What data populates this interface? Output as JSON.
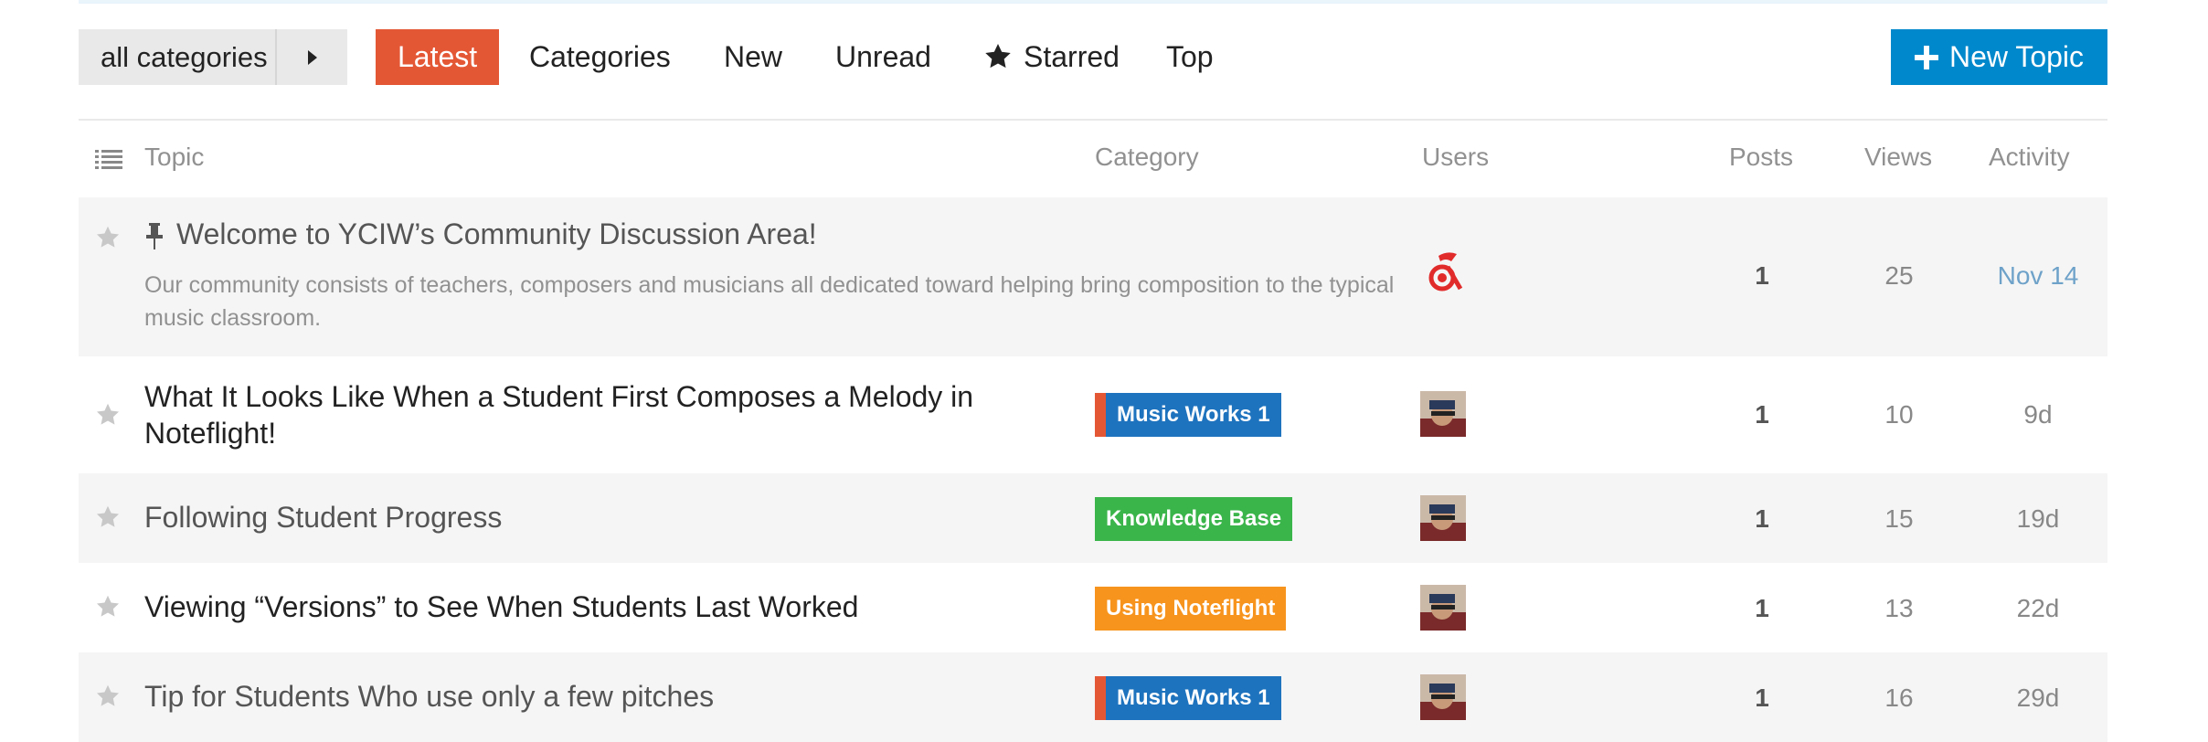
{
  "nav": {
    "category_dropdown": "all categories",
    "items": [
      {
        "label": "Latest",
        "active": true
      },
      {
        "label": "Categories",
        "active": false
      },
      {
        "label": "New",
        "active": false
      },
      {
        "label": "Unread",
        "active": false
      },
      {
        "label": "Starred",
        "active": false,
        "icon": "star-icon"
      },
      {
        "label": "Top",
        "active": false
      }
    ],
    "new_topic_label": "New Topic"
  },
  "columns": {
    "topic": "Topic",
    "category": "Category",
    "users": "Users",
    "posts": "Posts",
    "views": "Views",
    "activity": "Activity"
  },
  "topics": [
    {
      "title": "Welcome to YCIW’s Community Discussion Area!",
      "pinned": true,
      "excerpt": "Our community consists of teachers, composers and musicians all dedicated toward helping bring composition to the typical music classroom.",
      "category": "",
      "posts": "1",
      "views": "25",
      "activity": "Nov 14"
    },
    {
      "title": "What It Looks Like When a Student First Composes a Melody in Noteflight!",
      "category": "Music Works 1",
      "category_color": "#1e73be",
      "parent_color": "#e45735",
      "posts": "1",
      "views": "10",
      "activity": "9d"
    },
    {
      "title": "Following Student Progress",
      "category": "Knowledge Base",
      "category_color": "#3ab54a",
      "posts": "1",
      "views": "15",
      "activity": "19d"
    },
    {
      "title": "Viewing “Versions” to See When Students Last Worked",
      "category": "Using Noteflight",
      "category_color": "#f7941d",
      "posts": "1",
      "views": "13",
      "activity": "22d"
    },
    {
      "title": "Tip for Students Who use only a few pitches",
      "category": "Music Works 1",
      "category_color": "#1e73be",
      "parent_color": "#e45735",
      "posts": "1",
      "views": "16",
      "activity": "29d"
    }
  ]
}
